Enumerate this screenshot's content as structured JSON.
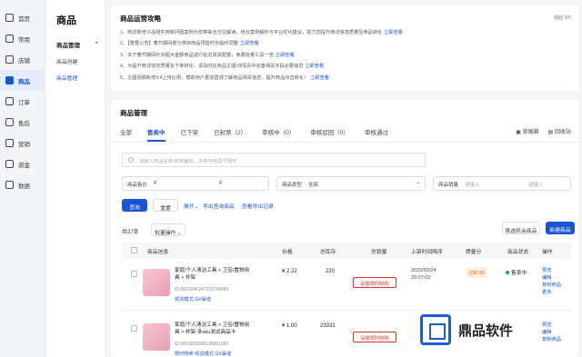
{
  "sidebar": {
    "items": [
      {
        "label": "首页",
        "icon": "home-icon"
      },
      {
        "label": "常用",
        "icon": "folder-icon"
      },
      {
        "label": "店铺",
        "icon": "store-icon"
      },
      {
        "label": "商品",
        "icon": "bag-icon"
      },
      {
        "label": "订单",
        "icon": "order-icon"
      },
      {
        "label": "售后",
        "icon": "aftersale-icon"
      },
      {
        "label": "营销",
        "icon": "marketing-icon"
      },
      {
        "label": "资金",
        "icon": "wallet-icon"
      },
      {
        "label": "数据",
        "icon": "data-icon"
      }
    ]
  },
  "subnav": {
    "title": "商品",
    "group": "商品管理",
    "items": [
      "商品创建",
      "商品管理"
    ]
  },
  "notice": {
    "title": "商品运营攻略",
    "collapse": "收起 5/5",
    "lines": [
      {
        "text": "1、商详新增子品组件商频问题案例为您带来全方位解读，结合案例解析与平台优化建议，助力您提升商详信息质量及商品转化",
        "link": "立即查看"
      },
      {
        "text": "2、【重要公告】春节期间部分类目商品预售时长临时调整",
        "link": "立即查看"
      },
      {
        "text": "3、关于春节期间针对超大金额商品进行延迟发货配置，免费批量工具一览",
        "link": "立即查看"
      },
      {
        "text": "4、为提升商详信息质量及下单转化，请及时在商品主图/详情页中完善相关字段必要信息",
        "link": "立即查看"
      },
      {
        "text": "5、主图视频新增3:4上传比例，帮助用户更加直观了解商品相关信息，提升商品点击转化！",
        "link": "立即查看"
      }
    ]
  },
  "panel": {
    "title": "商品管理",
    "tabs": [
      "全部",
      "售卖中",
      "已下架",
      "已封禁（2）",
      "审核中（0）",
      "审核驳回（0）",
      "审核通过"
    ],
    "tools": [
      "草稿箱",
      "回收站"
    ],
    "search_placeholder": "请输入商品名称/商家编码，多条可用逗号隔开",
    "price_label": "商品售价",
    "price_currency": "¥",
    "type_label": "商品类型",
    "type_value": "全部",
    "sales_label": "商品销量",
    "sales_ph": "请输入",
    "query": "查询",
    "reset": "重置",
    "expand": "展开",
    "export_query": "导出查询商品",
    "view_export": "查看导出记录",
    "count": "共37条",
    "batch": "批量操作",
    "opportunity": "挑选机会商品",
    "new_product": "新建商品"
  },
  "table": {
    "headers": [
      "商品信息",
      "价格",
      "总库存",
      "总销量",
      "上架时间降序",
      "质量分",
      "商品状态",
      "操作"
    ],
    "rows": [
      {
        "name": "家庭/个人清洁工具 > 卫浴/置物用具 > 杯架",
        "id": "ID:3601646347025744969",
        "tags": "现货模式  GX渠道",
        "price": "¥ 2.22",
        "stock": "220",
        "limit": "设置限时抢购",
        "date": "2023/02/24",
        "time": "20:07:02",
        "quality": "达标 80",
        "status": "售卖中",
        "ops": [
          "预览",
          "编辑",
          "复制商品",
          "更多"
        ]
      },
      {
        "name": "家庭/个人清洁工具 > 卫浴/置物用具 > 杯架-多sku测试商品卡",
        "id": "ID:3601828058135861065",
        "tags": "限时特卖  现货模式  GX渠道",
        "price": "¥ 1.00",
        "stock": "23331",
        "limit": "设置限时抢购",
        "date": "",
        "time": "",
        "quality": "",
        "status": "",
        "ops": [
          "预览",
          "编辑",
          "复制商品"
        ]
      }
    ]
  },
  "watermark": {
    "text": "鼎品软件"
  }
}
